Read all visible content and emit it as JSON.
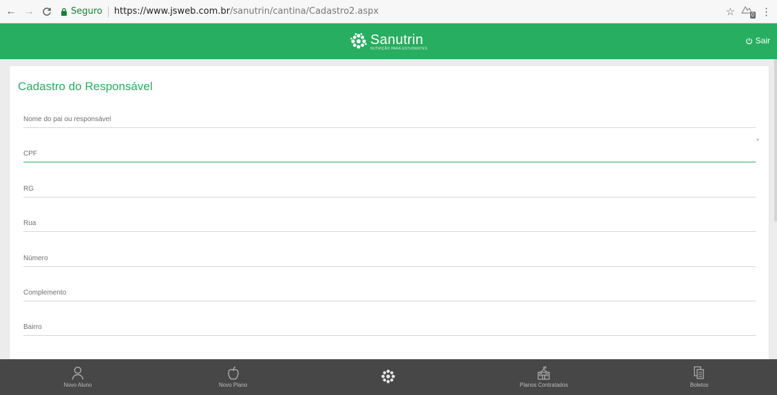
{
  "browser": {
    "secure_label": "Seguro",
    "url_host": "https://www.jsweb.com.br",
    "url_path": "/sanutrin/cantina/Cadastro2.aspx",
    "extension_badge": "0"
  },
  "header": {
    "brand_name": "Sanutrin",
    "brand_tagline": "NUTRIÇÃO PARA ESTUDANTES",
    "logout_label": "Sair",
    "color": "#27ae60"
  },
  "form": {
    "title": "Cadastro do Responsável",
    "required_mark": "*",
    "fields": [
      {
        "placeholder": "Nome do pai ou responsável",
        "value": ""
      },
      {
        "placeholder": "CPF",
        "value": ""
      },
      {
        "placeholder": "RG",
        "value": ""
      },
      {
        "placeholder": "Rua",
        "value": ""
      },
      {
        "placeholder": "Número",
        "value": ""
      },
      {
        "placeholder": "Complemento",
        "value": ""
      },
      {
        "placeholder": "Bairro",
        "value": ""
      }
    ]
  },
  "bottom_nav": {
    "items": [
      {
        "label": "Novo Aluno",
        "icon": "user-icon"
      },
      {
        "label": "Novo Plano",
        "icon": "apple-icon"
      },
      {
        "label": "",
        "icon": "logo-icon"
      },
      {
        "label": "Planos Contratados",
        "icon": "school-icon"
      },
      {
        "label": "Boletos",
        "icon": "documents-icon"
      }
    ]
  }
}
